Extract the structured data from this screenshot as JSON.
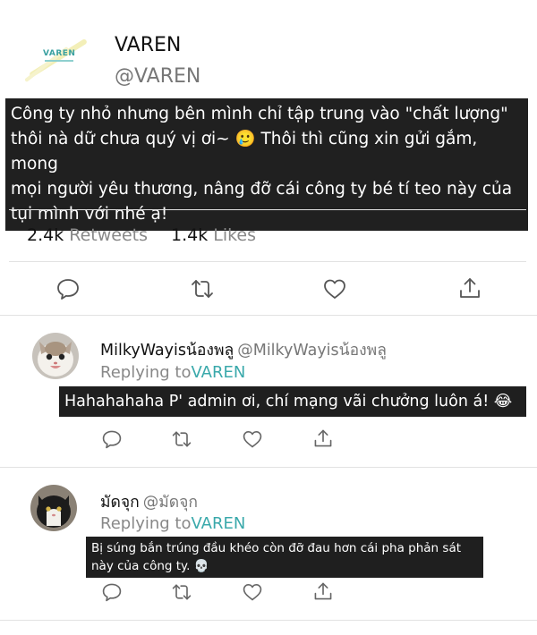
{
  "tweet": {
    "author_name": "VAREN",
    "author_handle": "@VAREN",
    "logo_text": "VAREN",
    "text": "Công ty nhỏ nhưng bên mình chỉ tập trung vào \"chất lượng\"\nthôi nà dữ chưa quý vị ơi~ 🥲 Thôi thì cũng xin gửi gắm, mong\nmọi người yêu thương, nâng đỡ cái công ty bé tí teo này của\ntụi mình với nhé ạ!",
    "retweets_count": "2.4k",
    "retweets_label": "Retweets",
    "likes_count": "1.4k",
    "likes_label": "Likes"
  },
  "replies": [
    {
      "name": "MilkyWayisน้องพลู",
      "handle": "@MilkyWayisน้องพลู",
      "replying_prefix": "Replying to",
      "replying_target": "VAREN",
      "text": "Hahahahaha P' admin ơi, chí mạng vãi chưởng luôn á! 😂"
    },
    {
      "name": "มัดจุก",
      "handle": "@มัดจุก",
      "replying_prefix": "Replying to",
      "replying_target": "VAREN",
      "text": "Bị súng bắn trúng đầu khéo còn đỡ đau hơn cái pha phản sát\nnày của công ty. 💀"
    }
  ],
  "icons": {
    "reply": "speech-bubble-icon",
    "retweet": "retweet-icon",
    "like": "heart-icon",
    "share": "share-icon"
  },
  "colors": {
    "accent": "#3aa9ab",
    "text_highlight_bg": "#202020",
    "muted": "#888888"
  }
}
